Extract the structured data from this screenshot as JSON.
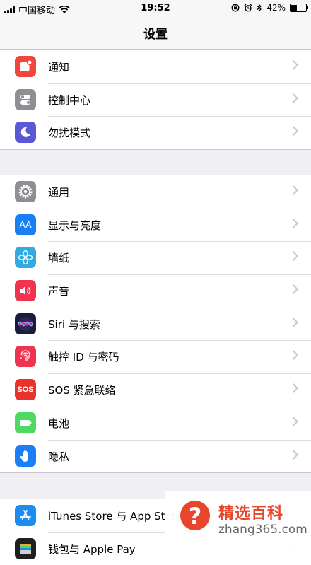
{
  "status_bar": {
    "carrier": "中国移动",
    "time": "19:52",
    "battery": "42%",
    "battery_level": 0.42,
    "icons": [
      "signal-icon",
      "wifi-icon",
      "rotation-lock-icon",
      "alarm-icon",
      "bluetooth-icon",
      "battery-icon"
    ]
  },
  "nav": {
    "title": "设置"
  },
  "groups": [
    {
      "items": [
        {
          "label": "通知",
          "icon": "notifications-icon",
          "color": "#f2453d"
        },
        {
          "label": "控制中心",
          "icon": "control-center-icon",
          "color": "#8e8e93"
        },
        {
          "label": "勿扰模式",
          "icon": "moon-icon",
          "color": "#5b58d6"
        }
      ]
    },
    {
      "items": [
        {
          "label": "通用",
          "icon": "gear-icon",
          "color": "#8e8e93"
        },
        {
          "label": "显示与亮度",
          "icon": "display-icon",
          "color": "#1a7ef5",
          "glyph": "AA"
        },
        {
          "label": "墙纸",
          "icon": "wallpaper-icon",
          "color": "#35aadc"
        },
        {
          "label": "声音",
          "icon": "speaker-icon",
          "color": "#f0334f"
        },
        {
          "label": "Siri 与搜索",
          "icon": "siri-icon",
          "color": "#1c1c3a"
        },
        {
          "label": "触控 ID 与密码",
          "icon": "fingerprint-icon",
          "color": "#f0334f"
        },
        {
          "label": "SOS 紧急联络",
          "icon": "sos-icon",
          "color": "#e8332c",
          "glyph": "SOS"
        },
        {
          "label": "电池",
          "icon": "battery-setting-icon",
          "color": "#4cd964"
        },
        {
          "label": "隐私",
          "icon": "hand-icon",
          "color": "#1a7ef5"
        }
      ]
    },
    {
      "items": [
        {
          "label": "iTunes Store 与 App Store",
          "icon": "app-store-icon",
          "color": "#1a8cf2"
        },
        {
          "label": "钱包与 Apple Pay",
          "icon": "wallet-icon",
          "color": "#1f1f1f"
        }
      ]
    }
  ],
  "watermark": {
    "title": "精选百科",
    "url": "zhang365.com",
    "glyph": "?"
  }
}
